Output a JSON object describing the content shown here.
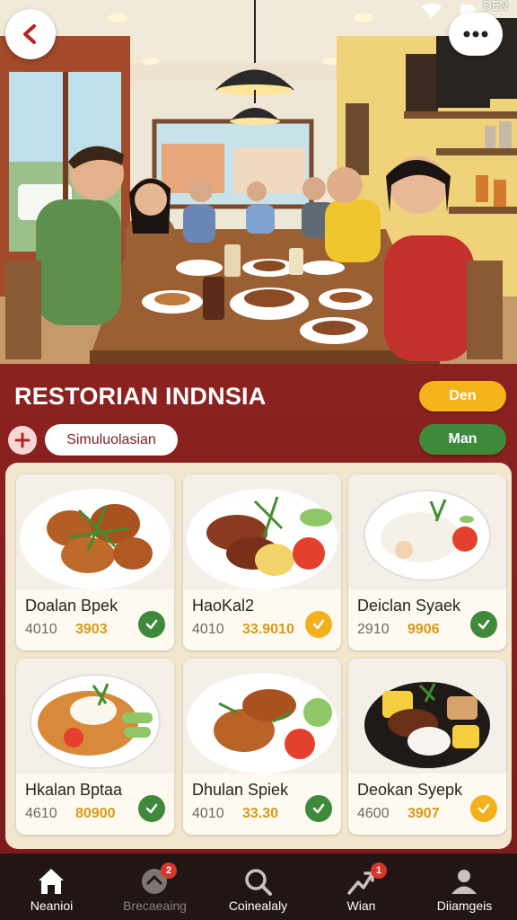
{
  "status_bar": {
    "time": "DEN"
  },
  "header": {
    "title": "RESTORIAN INDNSIA",
    "primary_button": "Den",
    "secondary_button": "Man",
    "filter_chip": "Simuluolasian"
  },
  "menu": {
    "items": [
      {
        "name": "Doalan Bpek",
        "code": "4010",
        "price": "3903",
        "check_color": "#3e8a3a"
      },
      {
        "name": "HaoKal2",
        "code": "4010",
        "price": "33.9010",
        "check_color": "#f2b11c"
      },
      {
        "name": "Deiclan Syaek",
        "code": "2910",
        "price": "9906",
        "check_color": "#3e8a3a"
      },
      {
        "name": "Hkalan Bptaa",
        "code": "4610",
        "price": "80900",
        "check_color": "#3e8a3a"
      },
      {
        "name": "Dhulan Spiek",
        "code": "4010",
        "price": "33.30",
        "check_color": "#3e8a3a"
      },
      {
        "name": "Deokan Syepk",
        "code": "4600",
        "price": "3907",
        "check_color": "#f2b11c"
      }
    ]
  },
  "nav": {
    "items": [
      {
        "label": "Neanioi",
        "icon": "home-icon"
      },
      {
        "label": "Brecaeaing",
        "icon": "tag-icon",
        "badge": "2"
      },
      {
        "label": "Coinealaly",
        "icon": "search-icon"
      },
      {
        "label": "Wian",
        "icon": "chart-icon",
        "badge": "1"
      },
      {
        "label": "Diiamgeis",
        "icon": "profile-icon"
      }
    ]
  },
  "colors": {
    "panel": "#8a1f1d",
    "accent_yellow": "#f6b41c",
    "accent_green": "#3e8a3a",
    "card_bg": "#fffaf1",
    "nav_bg": "#211614"
  }
}
